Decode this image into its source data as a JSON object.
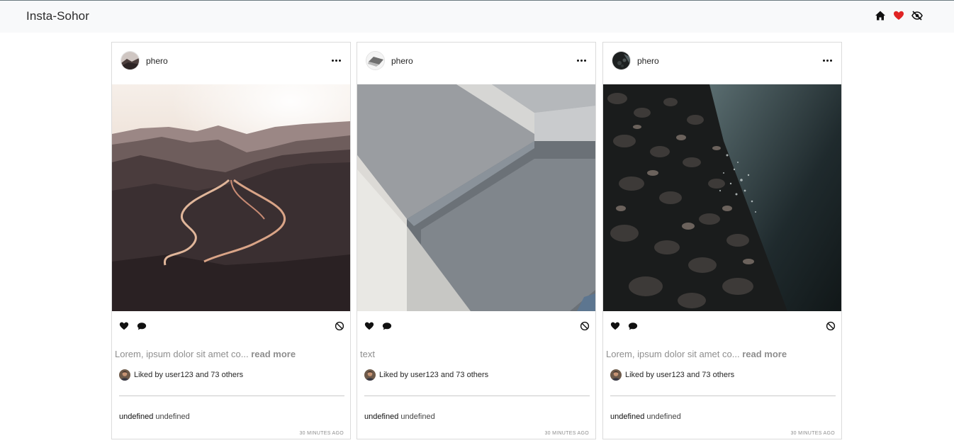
{
  "navbar": {
    "brand": "Insta-Sohor",
    "icons": [
      "home-icon",
      "heart-icon",
      "eye-slash-icon"
    ],
    "heart_color": "#e02424"
  },
  "posts": [
    {
      "username": "phero",
      "image": "mountain road at sunset",
      "caption_text": "Lorem, ipsum dolor sit amet co...",
      "read_more": "read more",
      "liked_by_prefix": "Liked by",
      "liked_by_user": "user123",
      "liked_by_and": "and",
      "liked_by_others": "73 others",
      "comment_user": "undefined",
      "comment_text": "undefined",
      "time": "30 MINUTES AGO"
    },
    {
      "username": "phero",
      "image": "abstract grey 3D shapes",
      "caption_text": "text",
      "read_more": "",
      "liked_by_prefix": "Liked by",
      "liked_by_user": "user123",
      "liked_by_and": "and",
      "liked_by_others": "73 others",
      "comment_user": "undefined",
      "comment_text": "undefined",
      "time": "30 MINUTES AGO"
    },
    {
      "username": "phero",
      "image": "pebbles and water shore",
      "caption_text": "Lorem, ipsum dolor sit amet co...",
      "read_more": "read more",
      "liked_by_prefix": "Liked by",
      "liked_by_user": "user123",
      "liked_by_and": "and",
      "liked_by_others": "73 others",
      "comment_user": "undefined",
      "comment_text": "undefined",
      "time": "30 MINUTES AGO"
    }
  ]
}
